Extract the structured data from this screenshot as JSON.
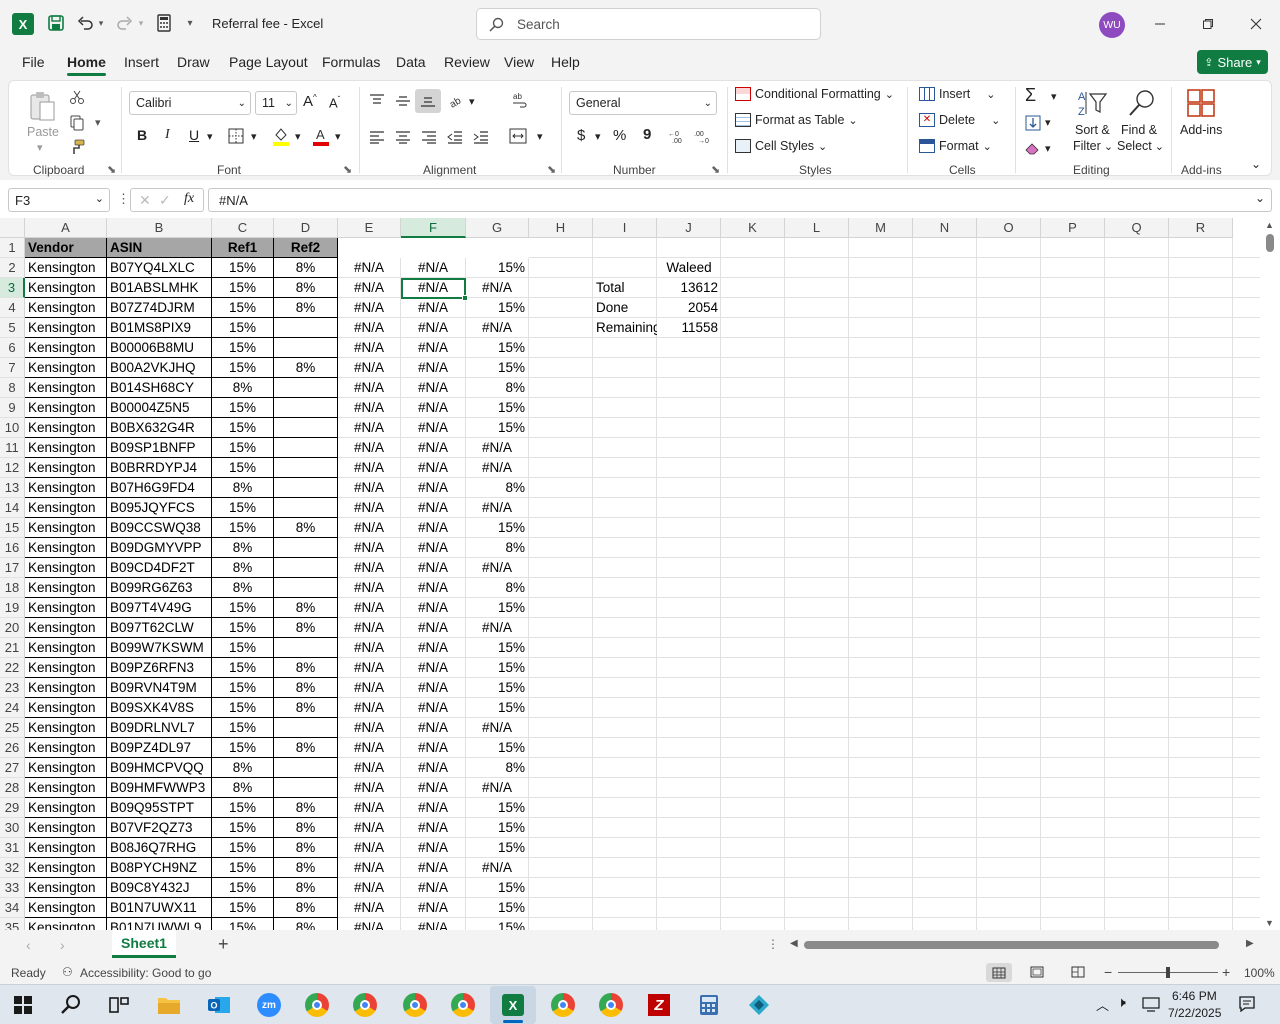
{
  "title_bar": {
    "file_name": "Referral fee",
    "app_name": "Excel",
    "separator": " - ",
    "search_placeholder": "Search",
    "user_initials": "WU"
  },
  "tabs": [
    "File",
    "Home",
    "Insert",
    "Draw",
    "Page Layout",
    "Formulas",
    "Data",
    "Review",
    "View",
    "Help"
  ],
  "share_label": "Share",
  "ribbon": {
    "clipboard": {
      "paste": "Paste",
      "label": "Clipboard"
    },
    "font": {
      "name": "Calibri",
      "size": "11",
      "label": "Font",
      "bold": "B",
      "italic": "I",
      "underline": "U"
    },
    "alignment": {
      "label": "Alignment"
    },
    "number": {
      "format": "General",
      "label": "Number",
      "currency": "$",
      "percent": "%",
      "comma": "9"
    },
    "styles": {
      "conditional": "Conditional Formatting",
      "format_table": "Format as Table",
      "cell_styles": "Cell Styles",
      "label": "Styles"
    },
    "cells": {
      "insert": "Insert",
      "delete": "Delete",
      "format": "Format",
      "label": "Cells"
    },
    "editing": {
      "sort_1": "Sort &",
      "sort_2": "Filter",
      "find_1": "Find &",
      "find_2": "Select",
      "label": "Editing"
    },
    "addins": {
      "btn": "Add-ins",
      "label": "Add-ins"
    }
  },
  "formula_bar": {
    "name_box": "F3",
    "fx": "fx",
    "formula": "#N/A"
  },
  "columns": [
    "A",
    "B",
    "C",
    "D",
    "E",
    "F",
    "G",
    "H",
    "I",
    "J",
    "K",
    "L",
    "M",
    "N",
    "O",
    "P",
    "Q",
    "R"
  ],
  "header_row": {
    "a": "Vendor",
    "b": "ASIN",
    "c": "Ref1",
    "d": "Ref2"
  },
  "rows": [
    {
      "n": "2",
      "a": "Kensington",
      "b": "B07YQ4LXLC",
      "c": "15%",
      "d": "8%",
      "e": "#N/A",
      "f": "#N/A",
      "g": "15%"
    },
    {
      "n": "3",
      "a": "Kensington",
      "b": "B01ABSLMHK",
      "c": "15%",
      "d": "8%",
      "e": "#N/A",
      "f": "#N/A",
      "g": "#N/A"
    },
    {
      "n": "4",
      "a": "Kensington",
      "b": "B07Z74DJRM",
      "c": "15%",
      "d": "8%",
      "e": "#N/A",
      "f": "#N/A",
      "g": "15%"
    },
    {
      "n": "5",
      "a": "Kensington",
      "b": "B01MS8PIX9",
      "c": "15%",
      "d": "",
      "e": "#N/A",
      "f": "#N/A",
      "g": "#N/A"
    },
    {
      "n": "6",
      "a": "Kensington",
      "b": "B00006B8MU",
      "c": "15%",
      "d": "",
      "e": "#N/A",
      "f": "#N/A",
      "g": "15%"
    },
    {
      "n": "7",
      "a": "Kensington",
      "b": "B00A2VKJHQ",
      "c": "15%",
      "d": "8%",
      "e": "#N/A",
      "f": "#N/A",
      "g": "15%"
    },
    {
      "n": "8",
      "a": "Kensington",
      "b": "B014SH68CY",
      "c": "8%",
      "d": "",
      "e": "#N/A",
      "f": "#N/A",
      "g": "8%"
    },
    {
      "n": "9",
      "a": "Kensington",
      "b": "B00004Z5N5",
      "c": "15%",
      "d": "",
      "e": "#N/A",
      "f": "#N/A",
      "g": "15%"
    },
    {
      "n": "10",
      "a": "Kensington",
      "b": "B0BX632G4R",
      "c": "15%",
      "d": "",
      "e": "#N/A",
      "f": "#N/A",
      "g": "15%"
    },
    {
      "n": "11",
      "a": "Kensington",
      "b": "B09SP1BNFP",
      "c": "15%",
      "d": "",
      "e": "#N/A",
      "f": "#N/A",
      "g": "#N/A"
    },
    {
      "n": "12",
      "a": "Kensington",
      "b": "B0BRRDYPJ4",
      "c": "15%",
      "d": "",
      "e": "#N/A",
      "f": "#N/A",
      "g": "#N/A"
    },
    {
      "n": "13",
      "a": "Kensington",
      "b": "B07H6G9FD4",
      "c": "8%",
      "d": "",
      "e": "#N/A",
      "f": "#N/A",
      "g": "8%"
    },
    {
      "n": "14",
      "a": "Kensington",
      "b": "B095JQYFCS",
      "c": "15%",
      "d": "",
      "e": "#N/A",
      "f": "#N/A",
      "g": "#N/A"
    },
    {
      "n": "15",
      "a": "Kensington",
      "b": "B09CCSWQ38",
      "c": "15%",
      "d": "8%",
      "e": "#N/A",
      "f": "#N/A",
      "g": "15%"
    },
    {
      "n": "16",
      "a": "Kensington",
      "b": "B09DGMYVPP",
      "c": "8%",
      "d": "",
      "e": "#N/A",
      "f": "#N/A",
      "g": "8%"
    },
    {
      "n": "17",
      "a": "Kensington",
      "b": "B09CD4DF2T",
      "c": "8%",
      "d": "",
      "e": "#N/A",
      "f": "#N/A",
      "g": "#N/A"
    },
    {
      "n": "18",
      "a": "Kensington",
      "b": "B099RG6Z63",
      "c": "8%",
      "d": "",
      "e": "#N/A",
      "f": "#N/A",
      "g": "8%"
    },
    {
      "n": "19",
      "a": "Kensington",
      "b": "B097T4V49G",
      "c": "15%",
      "d": "8%",
      "e": "#N/A",
      "f": "#N/A",
      "g": "15%"
    },
    {
      "n": "20",
      "a": "Kensington",
      "b": "B097T62CLW",
      "c": "15%",
      "d": "8%",
      "e": "#N/A",
      "f": "#N/A",
      "g": "#N/A"
    },
    {
      "n": "21",
      "a": "Kensington",
      "b": "B099W7KSWM",
      "c": "15%",
      "d": "",
      "e": "#N/A",
      "f": "#N/A",
      "g": "15%"
    },
    {
      "n": "22",
      "a": "Kensington",
      "b": "B09PZ6RFN3",
      "c": "15%",
      "d": "8%",
      "e": "#N/A",
      "f": "#N/A",
      "g": "15%"
    },
    {
      "n": "23",
      "a": "Kensington",
      "b": "B09RVN4T9M",
      "c": "15%",
      "d": "8%",
      "e": "#N/A",
      "f": "#N/A",
      "g": "15%"
    },
    {
      "n": "24",
      "a": "Kensington",
      "b": "B09SXK4V8S",
      "c": "15%",
      "d": "8%",
      "e": "#N/A",
      "f": "#N/A",
      "g": "15%"
    },
    {
      "n": "25",
      "a": "Kensington",
      "b": "B09DRLNVL7",
      "c": "15%",
      "d": "",
      "e": "#N/A",
      "f": "#N/A",
      "g": "#N/A"
    },
    {
      "n": "26",
      "a": "Kensington",
      "b": "B09PZ4DL97",
      "c": "15%",
      "d": "8%",
      "e": "#N/A",
      "f": "#N/A",
      "g": "15%"
    },
    {
      "n": "27",
      "a": "Kensington",
      "b": "B09HMCPVQQ",
      "c": "8%",
      "d": "",
      "e": "#N/A",
      "f": "#N/A",
      "g": "8%"
    },
    {
      "n": "28",
      "a": "Kensington",
      "b": "B09HMFWWP3",
      "c": "8%",
      "d": "",
      "e": "#N/A",
      "f": "#N/A",
      "g": "#N/A"
    },
    {
      "n": "29",
      "a": "Kensington",
      "b": "B09Q95STPT",
      "c": "15%",
      "d": "8%",
      "e": "#N/A",
      "f": "#N/A",
      "g": "15%"
    },
    {
      "n": "30",
      "a": "Kensington",
      "b": "B07VF2QZ73",
      "c": "15%",
      "d": "8%",
      "e": "#N/A",
      "f": "#N/A",
      "g": "15%"
    },
    {
      "n": "31",
      "a": "Kensington",
      "b": "B08J6Q7RHG",
      "c": "15%",
      "d": "8%",
      "e": "#N/A",
      "f": "#N/A",
      "g": "15%"
    },
    {
      "n": "32",
      "a": "Kensington",
      "b": "B08PYCH9NZ",
      "c": "15%",
      "d": "8%",
      "e": "#N/A",
      "f": "#N/A",
      "g": "#N/A"
    },
    {
      "n": "33",
      "a": "Kensington",
      "b": "B09C8Y432J",
      "c": "15%",
      "d": "8%",
      "e": "#N/A",
      "f": "#N/A",
      "g": "15%"
    },
    {
      "n": "34",
      "a": "Kensington",
      "b": "B01N7UWX11",
      "c": "15%",
      "d": "8%",
      "e": "#N/A",
      "f": "#N/A",
      "g": "15%"
    },
    {
      "n": "35",
      "a": "Kensington",
      "b": "B01N7UWWL9",
      "c": "15%",
      "d": "8%",
      "e": "#N/A",
      "f": "#N/A",
      "g": "15%"
    }
  ],
  "summary": {
    "name": "Waleed",
    "total_label": "Total",
    "total_value": "13612",
    "done_label": "Done",
    "done_value": "2054",
    "remaining_label": "Remaining",
    "remaining_value": "11558"
  },
  "sheet_tabs": [
    "Sheet1"
  ],
  "status": {
    "ready": "Ready",
    "accessibility": "Accessibility: Good to go",
    "zoom": "100%"
  },
  "taskbar": {
    "time": "6:46 PM",
    "date": "7/22/2025"
  },
  "colors": {
    "excel_green": "#107c41",
    "header_fill": "#a6a6a6",
    "avatar": "#8e4bbf",
    "share": "#107c41"
  }
}
